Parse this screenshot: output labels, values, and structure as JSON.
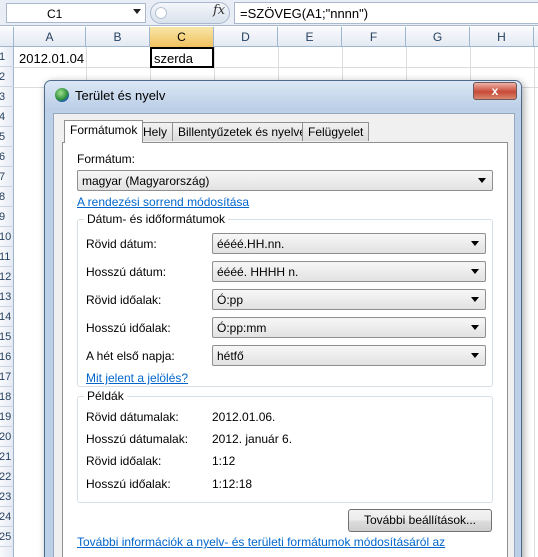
{
  "formula_bar": {
    "name_box": "C1",
    "fx": "fx",
    "formula": "=SZÖVEG(A1;\"nnnn\")"
  },
  "sheet": {
    "columns": [
      "A",
      "B",
      "C",
      "D",
      "E",
      "F",
      "G",
      "H"
    ],
    "rows": [
      "1",
      "2",
      "3",
      "4",
      "5",
      "6",
      "7",
      "8",
      "9",
      "10",
      "11",
      "12",
      "13",
      "14",
      "15",
      "16",
      "17",
      "18",
      "19",
      "20",
      "21",
      "22",
      "23",
      "24",
      "25"
    ],
    "cells": {
      "A1": "2012.01.04",
      "C1": "szerda"
    }
  },
  "dialog": {
    "title": "Terület és nyelv",
    "close": "x",
    "tabs": [
      "Formátumok",
      "Hely",
      "Billentyűzetek és nyelvek",
      "Felügyelet"
    ],
    "format_label": "Formátum:",
    "format_value": "magyar (Magyarország)",
    "sort_link": "A rendezési sorrend módosítása",
    "datetime_group": {
      "title": "Dátum- és időformátumok",
      "rows": [
        {
          "label": "Rövid dátum:",
          "value": "éééé.HH.nn."
        },
        {
          "label": "Hosszú dátum:",
          "value": "éééé. HHHH n."
        },
        {
          "label": "Rövid időalak:",
          "value": "Ó:pp"
        },
        {
          "label": "Hosszú időalak:",
          "value": "Ó:pp:mm"
        },
        {
          "label": "A hét első napja:",
          "value": "hétfő"
        }
      ],
      "notation_link": "Mit jelent a jelölés?"
    },
    "examples_group": {
      "title": "Példák",
      "rows": [
        {
          "label": "Rövid dátumalak:",
          "value": "2012.01.06."
        },
        {
          "label": "Hosszú dátumalak:",
          "value": "2012. január 6."
        },
        {
          "label": "Rövid időalak:",
          "value": "1:12"
        },
        {
          "label": "Hosszú időalak:",
          "value": "1:12:18"
        }
      ]
    },
    "more_settings_button": "További beállítások...",
    "bottom_link": "További információk a nyelv- és területi formátumok módosításáról az"
  }
}
